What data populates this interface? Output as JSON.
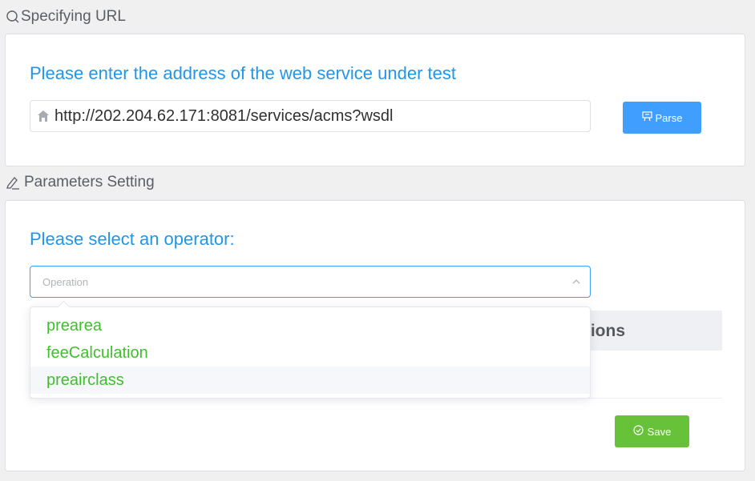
{
  "url_section": {
    "header": "Specifying URL",
    "prompt": "Please enter the address of the web service under test",
    "url_value": "http://202.204.62.171:8081/services/acms?wsdl",
    "parse_label": "Parse"
  },
  "params_section": {
    "header": "Parameters Setting",
    "prompt": "Please select an operator:",
    "select_placeholder": "Operation",
    "table_header_partial": "ions",
    "save_label": "Save"
  },
  "dropdown": {
    "options": [
      "prearea",
      "feeCalculation",
      "preairclass"
    ],
    "hovered_index": 2
  },
  "colors": {
    "accent_blue": "#409eff",
    "prompt_blue": "#2196e8",
    "option_green": "#3fbf2c",
    "save_green": "#67c23a"
  },
  "icons": [
    "search-icon",
    "home-icon",
    "parse-icon",
    "edit-icon",
    "chevron-up-icon",
    "check-circle-icon"
  ]
}
